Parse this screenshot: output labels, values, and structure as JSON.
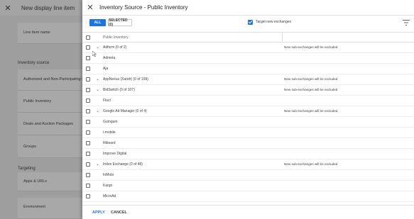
{
  "background": {
    "title": "New display line item",
    "line_item_name_label": "Line item name",
    "inventory_source_label": "Inventory source",
    "options": [
      "Authorized and Non-Participating Pu",
      "Public Inventory",
      "Deals and Auction Packages",
      "Groups"
    ],
    "targeting_label": "Targeting",
    "targeting_items": [
      "Apps & URLs",
      "Environment"
    ]
  },
  "dialog": {
    "title": "Inventory Source - Public Inventory",
    "tab_all": "ALL",
    "tab_selected": "SELECTED (0)",
    "target_new_exchanges": "Target new exchanges",
    "column_header": "Public Inventory",
    "rows": [
      {
        "name": "Adform (0 of 2)",
        "expandable": true,
        "note": "New sub-exchanges will be excluded"
      },
      {
        "name": "Admeta",
        "expandable": false,
        "note": ""
      },
      {
        "name": "Aja",
        "expandable": false,
        "note": ""
      },
      {
        "name": "AppNexus (Xandr) (0 of 199)",
        "expandable": true,
        "note": "New sub-exchanges will be excluded"
      },
      {
        "name": "BidSwitch (0 of 107)",
        "expandable": true,
        "note": "New sub-exchanges will be excluded"
      },
      {
        "name": "Fluct",
        "expandable": false,
        "note": ""
      },
      {
        "name": "Google Ad Manager (0 of 4)",
        "expandable": true,
        "note": "New sub-exchanges will be excluded"
      },
      {
        "name": "Gumgum",
        "expandable": false,
        "note": ""
      },
      {
        "name": "i-mobile",
        "expandable": false,
        "note": ""
      },
      {
        "name": "Illiboard",
        "expandable": false,
        "note": ""
      },
      {
        "name": "Improve Digital",
        "expandable": false,
        "note": ""
      },
      {
        "name": "Index Exchange (0 of 48)",
        "expandable": true,
        "note": "New sub-exchanges will be excluded"
      },
      {
        "name": "InMobi",
        "expandable": false,
        "note": ""
      },
      {
        "name": "Kargo",
        "expandable": false,
        "note": ""
      },
      {
        "name": "MicroAd",
        "expandable": false,
        "note": ""
      }
    ],
    "apply_label": "APPLY",
    "cancel_label": "CANCEL"
  },
  "colors": {
    "accent": "#1a73e8",
    "overlay": "#9e9e9e"
  }
}
